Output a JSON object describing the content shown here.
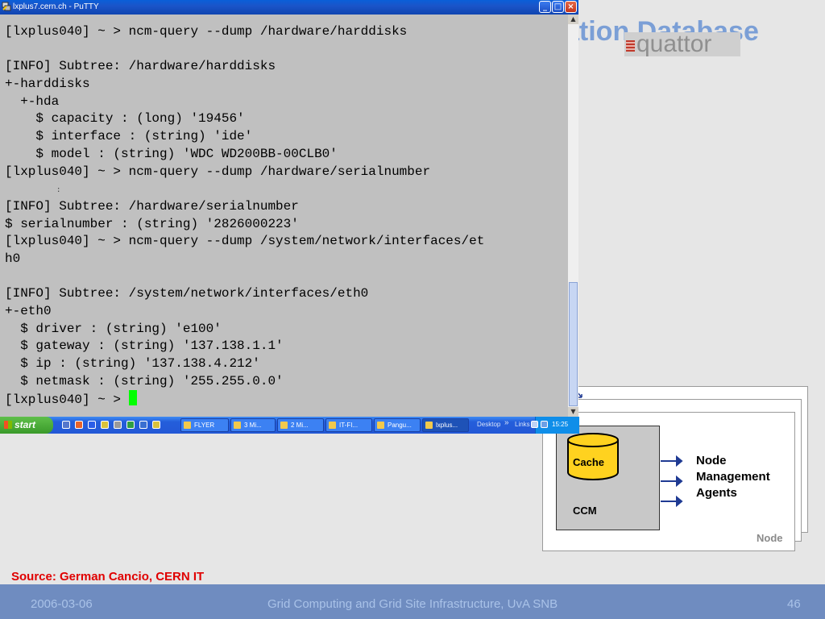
{
  "slide": {
    "title": "ation Database",
    "logo_text": "quattor",
    "node_label": "Node",
    "ccm_label": "CCM",
    "cache_label": "Cache",
    "agents_lines": [
      "Node",
      "Management",
      "Agents"
    ],
    "source": "Source: German Cancio, CERN IT",
    "footer": {
      "date": "2006-03-06",
      "title": "Grid Computing and Grid Site Infrastructure, UvA SNB",
      "page": "46"
    }
  },
  "window": {
    "title": "lxplus7.cern.ch - PuTTY",
    "minimize": "_",
    "maximize": "□",
    "close": "×"
  },
  "terminal": {
    "lines": [
      "[lxplus040] ~ > ncm-query --dump /hardware/harddisks",
      "",
      "[INFO] Subtree: /hardware/harddisks",
      "+-harddisks",
      "  +-hda",
      "    $ capacity : (long) '19456'",
      "    $ interface : (string) 'ide'",
      "    $ model : (string) 'WDC WD200BB-00CLB0'",
      "[lxplus040] ~ > ncm-query --dump /hardware/serialnumber",
      "",
      "[INFO] Subtree: /hardware/serialnumber",
      "$ serialnumber : (string) '2826000223'",
      "[lxplus040] ~ > ncm-query --dump /system/network/interfaces/et",
      "h0",
      "",
      "[INFO] Subtree: /system/network/interfaces/eth0",
      "+-eth0",
      "  $ driver : (string) 'e100'",
      "  $ gateway : (string) '137.138.1.1'",
      "  $ ip : (string) '137.138.4.212'",
      "  $ netmask : (string) '255.255.0.0'"
    ],
    "prompt": "[lxplus040] ~ > "
  },
  "taskbar": {
    "start_label": "start",
    "buttons": [
      {
        "label": "FLYER",
        "icon": "folder-icon"
      },
      {
        "label": "3 Mi...",
        "icon": "powerpoint-icon"
      },
      {
        "label": "2 Mi...",
        "icon": "app-icon"
      },
      {
        "label": "IT-FI...",
        "icon": "document-icon"
      },
      {
        "label": "Pangu...",
        "icon": "browser-icon"
      },
      {
        "label": "lxplus...",
        "icon": "putty-icon"
      }
    ],
    "desktop_label": "Desktop",
    "links_label": "Links",
    "chevron": "»",
    "clock": "15:25"
  },
  "colors": {
    "terminal_bg": "#c0c0c0",
    "cursor": "#00ff00",
    "titlebar": "#0a5fd8",
    "footer_bg": "#6f8cc0",
    "source_text": "#e00000"
  }
}
